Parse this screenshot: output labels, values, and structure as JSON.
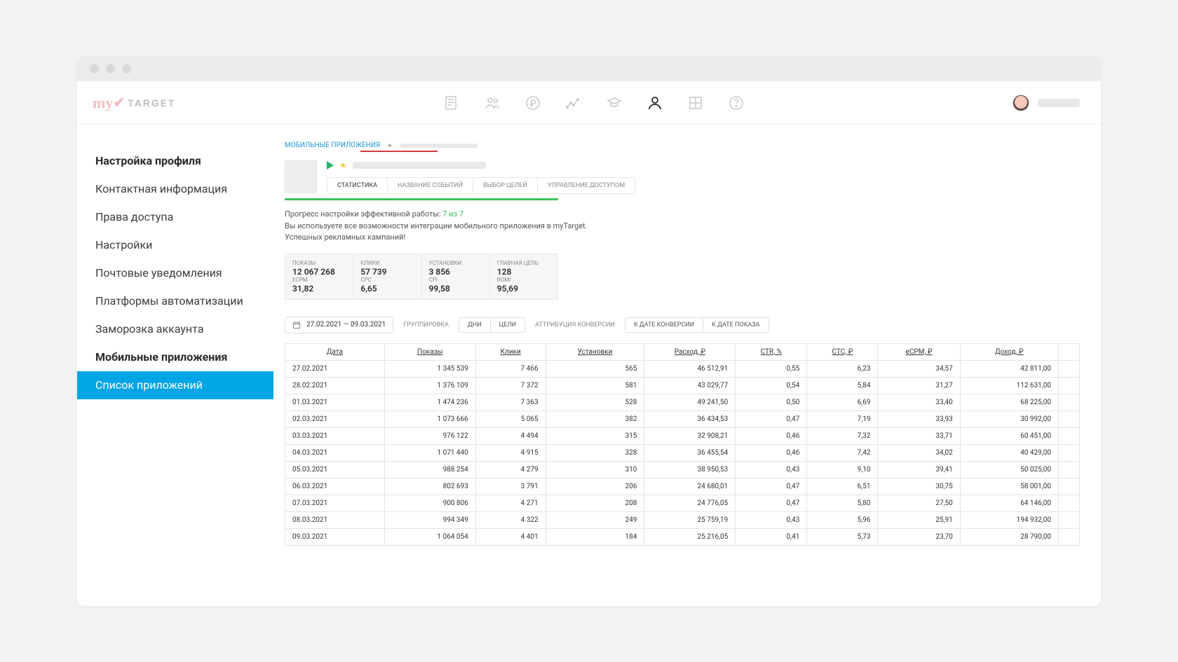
{
  "logo": {
    "brand": "my",
    "subbrand": "TARGET"
  },
  "sidebar": {
    "items": [
      {
        "label": "Настройка профиля",
        "bold": true
      },
      {
        "label": "Контактная информация"
      },
      {
        "label": "Права доступа"
      },
      {
        "label": "Настройки"
      },
      {
        "label": "Почтовые уведомления"
      },
      {
        "label": "Платформы автоматизации"
      },
      {
        "label": "Заморозка аккаунта"
      },
      {
        "label": "Мобильные приложения",
        "bold": true
      },
      {
        "label": "Список приложений",
        "active": true
      }
    ]
  },
  "breadcrumb": {
    "root": "МОБИЛЬНЫЕ ПРИЛОЖЕНИЯ"
  },
  "subtabs": [
    "СТАТИСТИКА",
    "НАЗВАНИЕ СОБЫТИЙ",
    "ВЫБОР ЦЕЛЕЙ",
    "УПРАВЛЕНИЕ ДОСТУПОМ"
  ],
  "progress": {
    "line1_prefix": "Прогресс настройки эффективной работы: ",
    "ratio": "7 из 7",
    "line2": "Вы используете все возможности интеграции мобильного приложения в myTarget.",
    "line3": "Успешных рекламных кампаний!"
  },
  "metrics": [
    {
      "label1": "ПОКАЗЫ",
      "value1": "12 067 268",
      "label2": "eCPM",
      "value2": "31,82"
    },
    {
      "label1": "КЛИКИ",
      "value1": "57 739",
      "label2": "CPC",
      "value2": "6,65"
    },
    {
      "label1": "УСТАНОВКИ",
      "value1": "3 856",
      "label2": "CPI",
      "value2": "99,58"
    },
    {
      "label1": "ГЛАВНАЯ ЦЕЛЬ",
      "value1": "128",
      "label2": "ROMI",
      "value2": "95,69"
    }
  ],
  "controls": {
    "date_range": "27.02.2021 — 09.03.2021",
    "group_label": "ГРУППИРОВКА",
    "group_options": [
      "ДНИ",
      "ЦЕЛИ"
    ],
    "attr_label": "АТТРИБУЦИЯ КОНВЕРСИИ",
    "attr_options": [
      "К ДАТЕ КОНВЕРСИИ",
      "К ДАТЕ ПОКАЗА"
    ]
  },
  "table": {
    "headers": [
      "Дата",
      "Показы",
      "Клики",
      "Установки",
      "Расход, ₽",
      "CTR, %",
      "CTC, ₽",
      "eCPM, ₽",
      "Доход, ₽",
      ""
    ],
    "rows": [
      [
        "27.02.2021",
        "1 345 539",
        "7 466",
        "565",
        "46 512,91",
        "0,55",
        "6,23",
        "34,57",
        "42 811,00",
        ""
      ],
      [
        "28.02.2021",
        "1 376 109",
        "7 372",
        "581",
        "43 029,77",
        "0,54",
        "5,84",
        "31,27",
        "112 631,00",
        ""
      ],
      [
        "01.03.2021",
        "1 474 236",
        "7 363",
        "528",
        "49 241,50",
        "0,50",
        "6,69",
        "33,40",
        "68 225,00",
        ""
      ],
      [
        "02.03.2021",
        "1 073 666",
        "5 065",
        "382",
        "36 434,53",
        "0,47",
        "7,19",
        "33,93",
        "30 992,00",
        ""
      ],
      [
        "03.03.2021",
        "976 122",
        "4 494",
        "315",
        "32 908,21",
        "0,46",
        "7,32",
        "33,71",
        "60 451,00",
        ""
      ],
      [
        "04.03.2021",
        "1 071 440",
        "4 915",
        "328",
        "36 455,54",
        "0,46",
        "7,42",
        "34,02",
        "40 429,00",
        ""
      ],
      [
        "05.03.2021",
        "988 254",
        "4 279",
        "310",
        "38 950,53",
        "0,43",
        "9,10",
        "39,41",
        "50 025,00",
        ""
      ],
      [
        "06.03.2021",
        "802 693",
        "3 791",
        "206",
        "24 680,01",
        "0,47",
        "6,51",
        "30,75",
        "58 001,00",
        ""
      ],
      [
        "07.03.2021",
        "900 806",
        "4 271",
        "208",
        "24 776,05",
        "0,47",
        "5,80",
        "27,50",
        "64 146,00",
        ""
      ],
      [
        "08.03.2021",
        "994 349",
        "4 322",
        "249",
        "25 759,19",
        "0,43",
        "5,96",
        "25,91",
        "194 932,00",
        ""
      ],
      [
        "09.03.2021",
        "1 064 054",
        "4 401",
        "184",
        "25 216,05",
        "0,41",
        "5,73",
        "23,70",
        "28 790,00",
        ""
      ]
    ]
  }
}
